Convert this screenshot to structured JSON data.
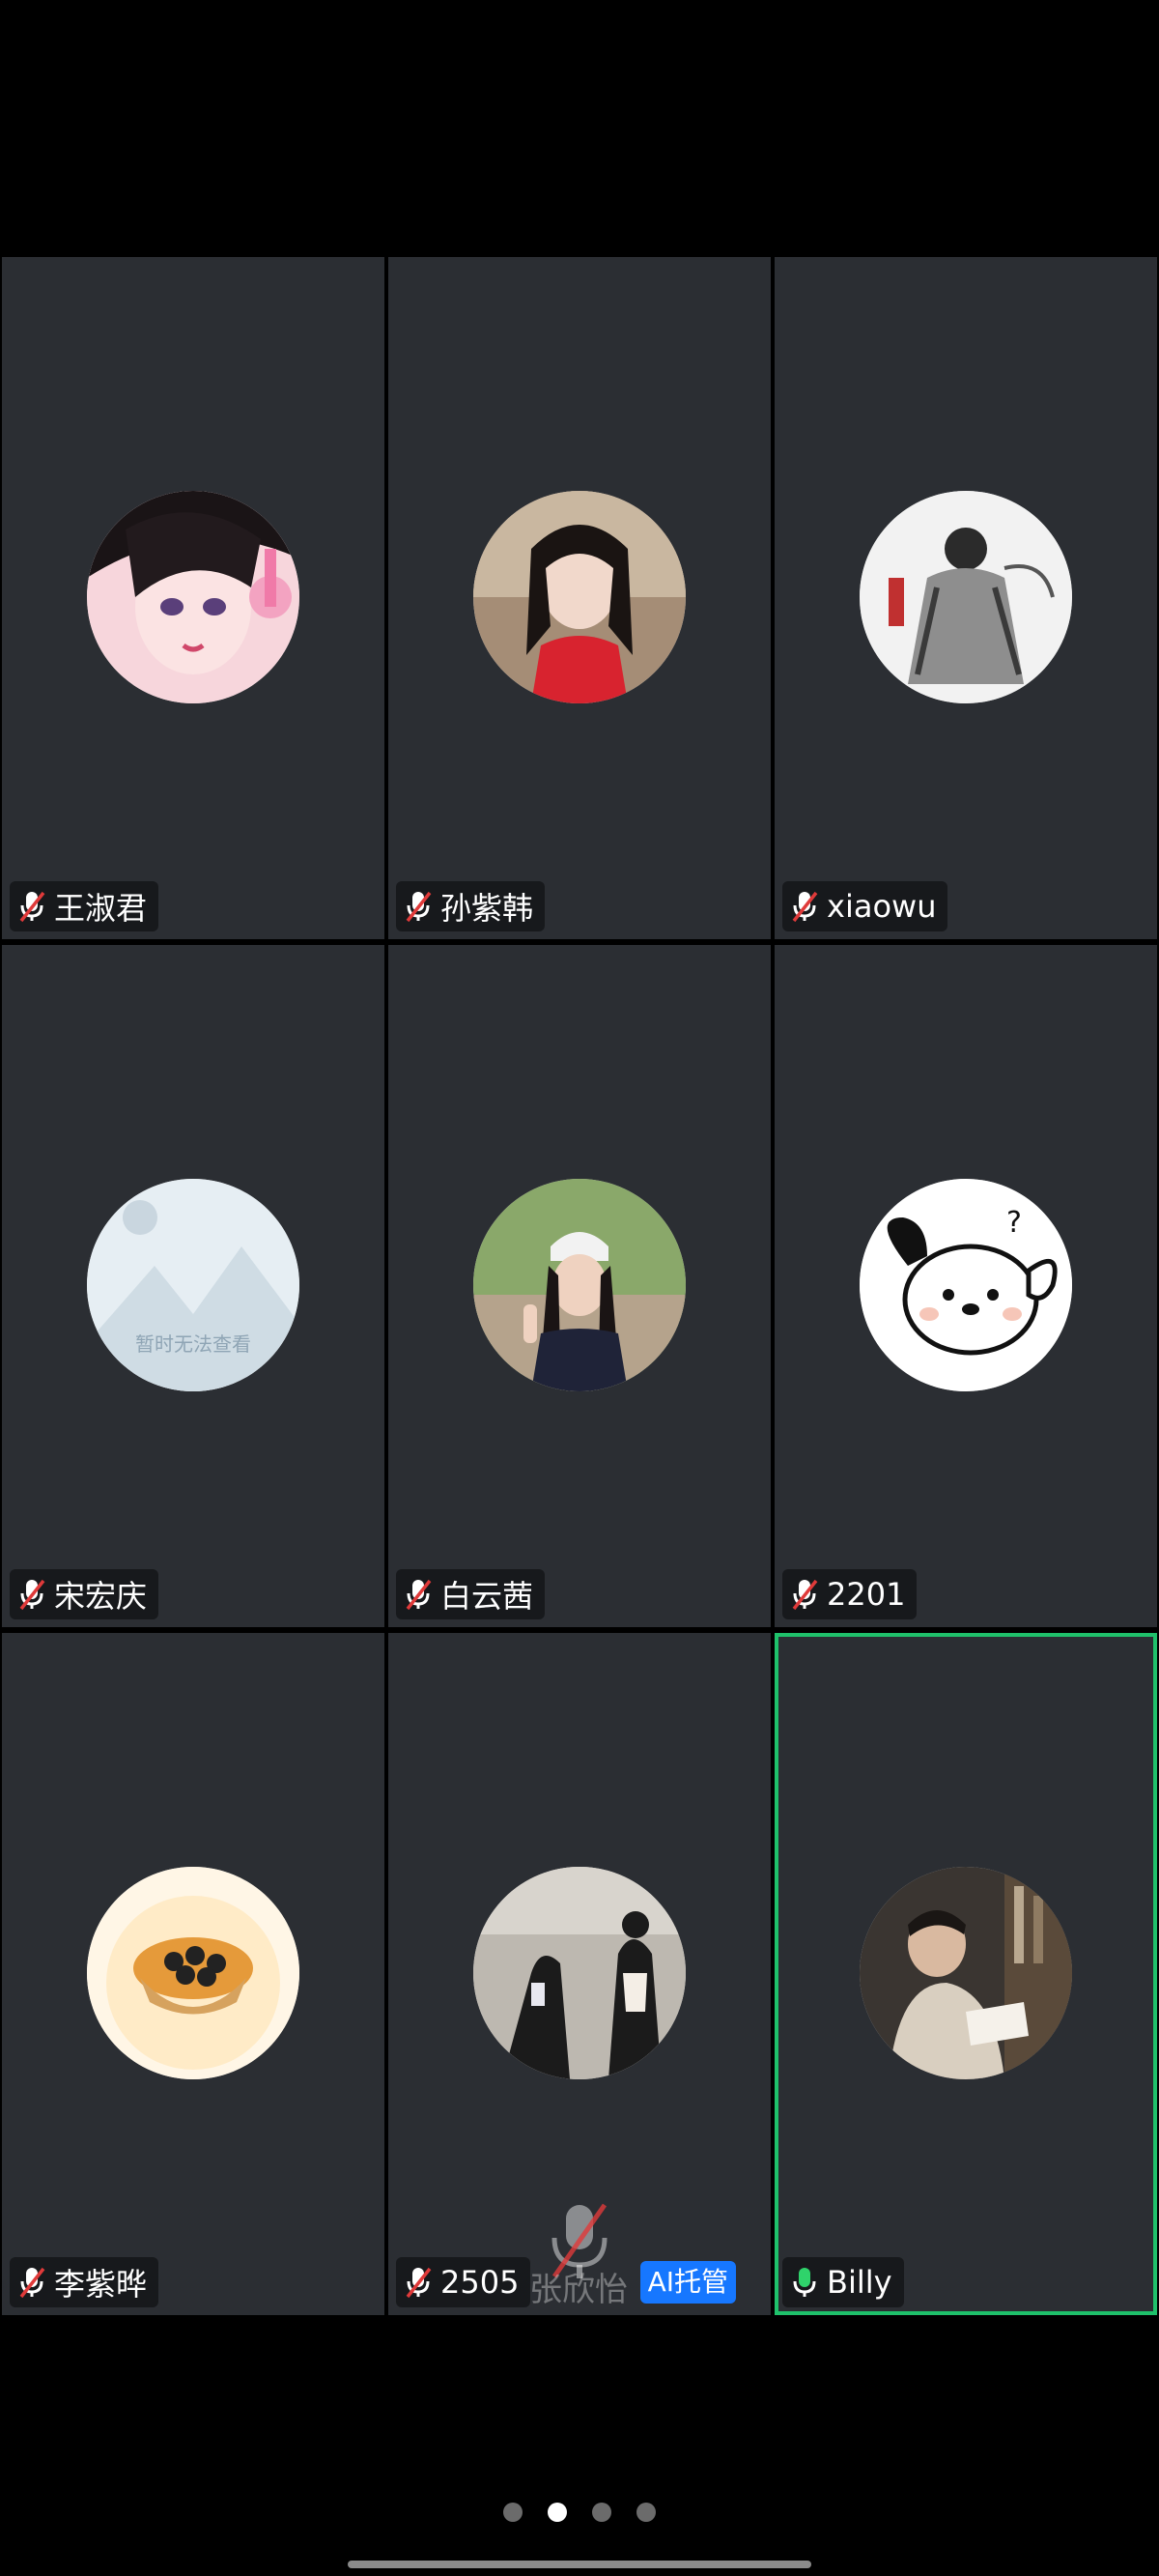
{
  "participants": [
    {
      "name": "王淑君",
      "mic": "muted",
      "avatar": "anime-girl-headphones-avatar"
    },
    {
      "name": "孙紫韩",
      "mic": "muted",
      "avatar": "girl-red-top-photo-avatar"
    },
    {
      "name": "xiaowu",
      "mic": "muted",
      "avatar": "ink-sketch-figure-avatar"
    },
    {
      "name": "宋宏庆",
      "mic": "muted",
      "avatar": "placeholder-unavailable-avatar",
      "avatar_text": "暂时无法查看"
    },
    {
      "name": "白云茜",
      "mic": "muted",
      "avatar": "girl-cap-peace-sign-avatar"
    },
    {
      "name": "2201",
      "mic": "muted",
      "avatar": "cartoon-dog-avatar"
    },
    {
      "name": "李紫晔",
      "mic": "muted",
      "avatar": "egg-tart-avatar"
    },
    {
      "name": "2505",
      "mic": "muted",
      "avatar": "two-girls-street-avatar",
      "overlay_name": "张欣怡",
      "badge": "AI托管"
    },
    {
      "name": "Billy",
      "mic": "active",
      "avatar": "man-reading-book-avatar",
      "active_speaker": true
    }
  ],
  "colors": {
    "tile_bg": "#2b2e33",
    "active_border": "#1fc16b",
    "mic_muted": "#e03a3a",
    "mic_active": "#2fd36b",
    "ai_badge": "#1677ff"
  },
  "pager": {
    "pages": 4,
    "current": 2
  }
}
